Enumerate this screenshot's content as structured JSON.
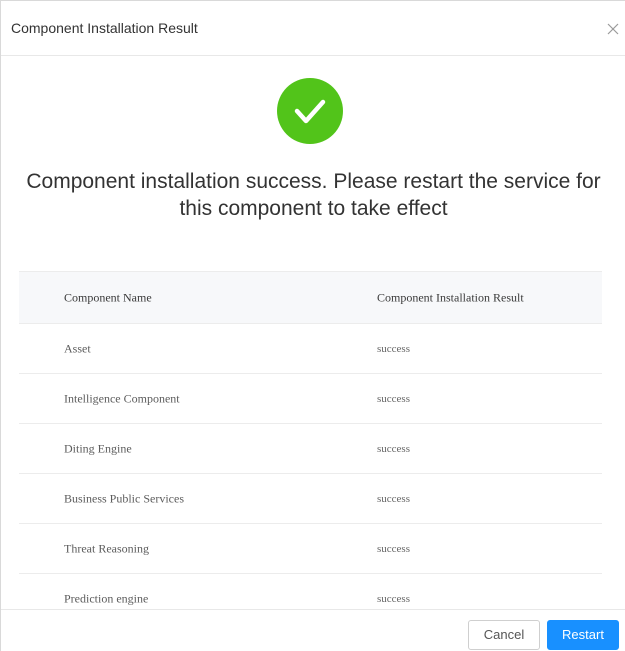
{
  "dialog": {
    "title": "Component Installation Result",
    "close_icon": "close-icon",
    "success_icon": "check-circle-icon",
    "message": "Component installation success. Please restart the service for this component to take effect"
  },
  "table": {
    "columns": [
      "Component Name",
      "Component Installation Result"
    ],
    "rows": [
      {
        "name": "Asset",
        "result": "success"
      },
      {
        "name": "Intelligence Component",
        "result": "success"
      },
      {
        "name": "Diting Engine",
        "result": "success"
      },
      {
        "name": "Business Public Services",
        "result": "success"
      },
      {
        "name": "Threat Reasoning",
        "result": "success"
      },
      {
        "name": "Prediction engine",
        "result": "success"
      }
    ]
  },
  "footer": {
    "cancel_label": "Cancel",
    "restart_label": "Restart"
  },
  "colors": {
    "success_green": "#52c41a",
    "primary_blue": "#1890ff"
  }
}
